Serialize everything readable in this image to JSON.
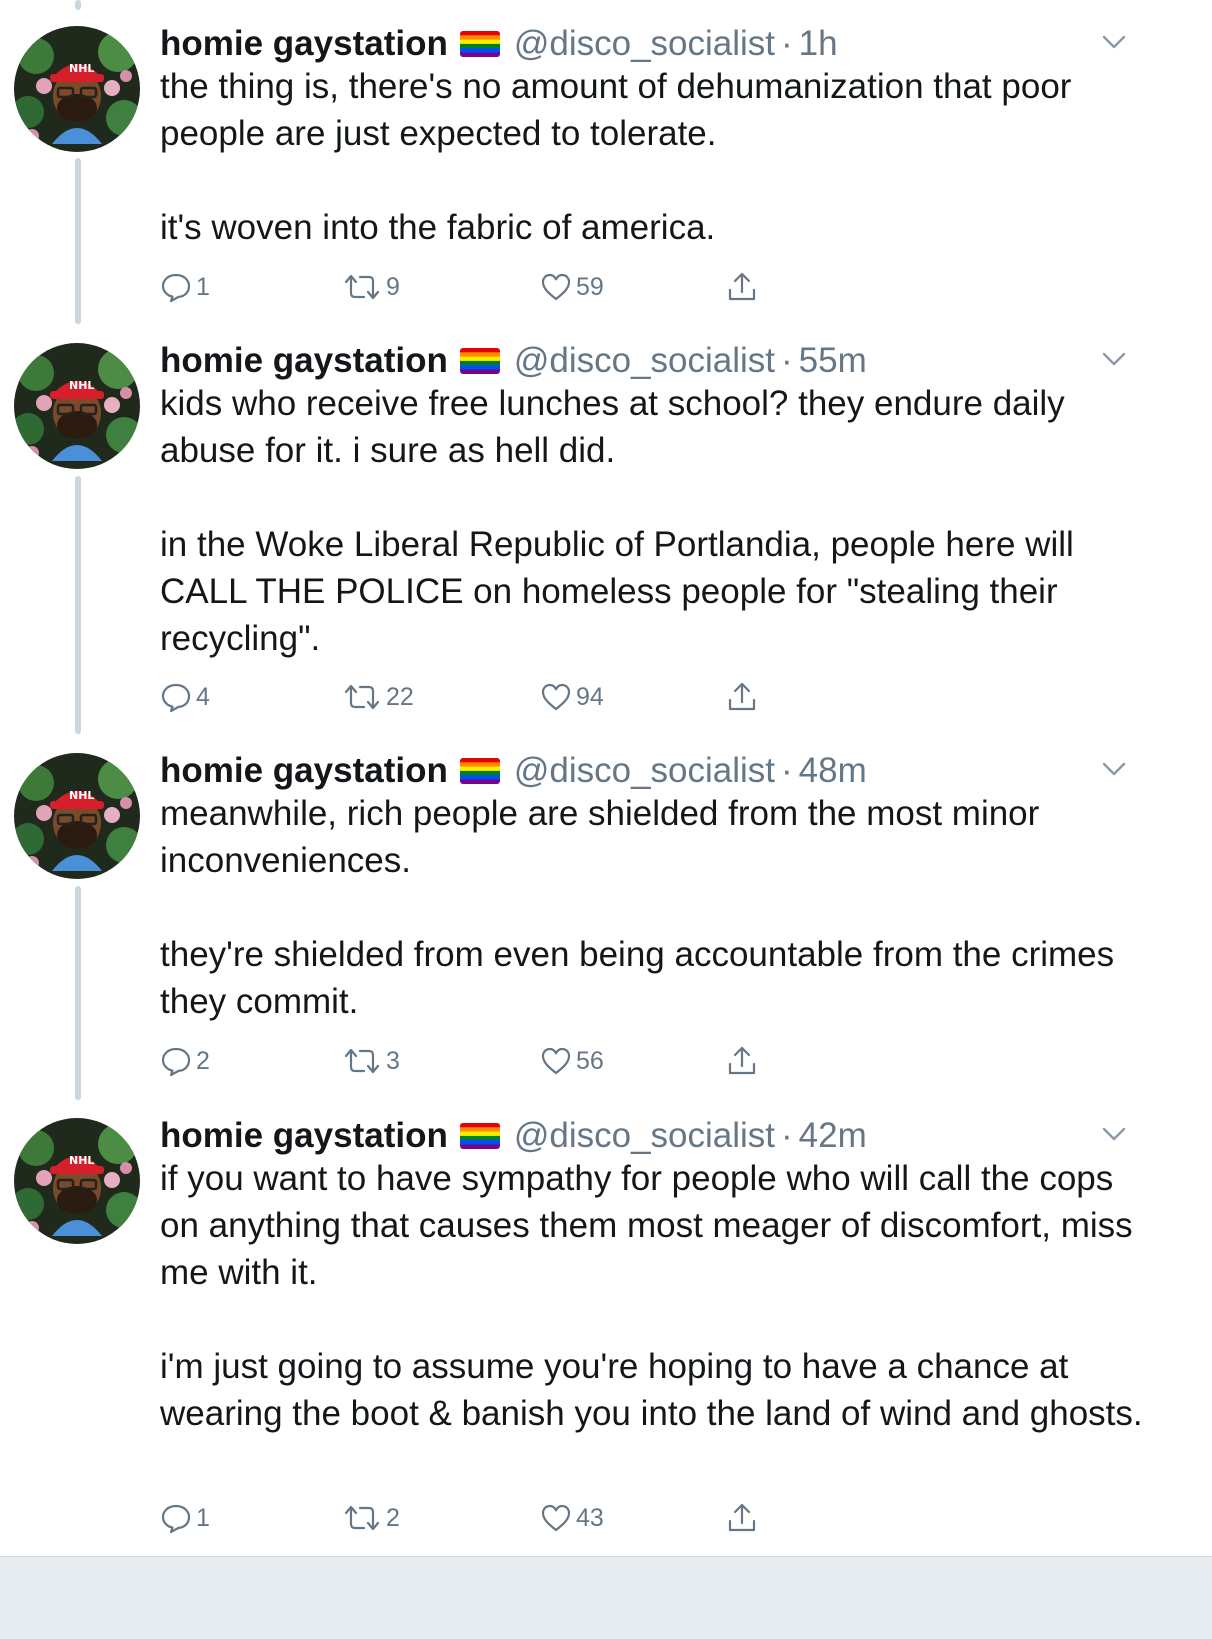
{
  "colors": {
    "text": "#14171a",
    "secondary": "#657786",
    "thread_line": "#ccd6dd"
  },
  "icons": {
    "reply": "speech-bubble-icon",
    "retweet": "retweet-arrows-icon",
    "like": "heart-outline-icon",
    "share": "share-upload-icon",
    "menu": "chevron-down-icon",
    "flag": "rainbow-flag-icon"
  },
  "tweets": [
    {
      "name": "homie gaystation",
      "handle": "@disco_socialist",
      "separator": "·",
      "time": "1h",
      "paragraphs": [
        "the thing is, there's no amount of dehumanization that poor people are just expected to tolerate.",
        "it's woven into the fabric of america."
      ],
      "replies": "1",
      "retweets": "9",
      "likes": "59"
    },
    {
      "name": "homie gaystation",
      "handle": "@disco_socialist",
      "separator": "·",
      "time": "55m",
      "paragraphs": [
        "kids who receive free lunches at school? they endure daily abuse for it. i sure as hell did.",
        "in the Woke Liberal Republic of Portlandia, people here will CALL THE POLICE on homeless people for \"stealing their recycling\"."
      ],
      "replies": "4",
      "retweets": "22",
      "likes": "94"
    },
    {
      "name": "homie gaystation",
      "handle": "@disco_socialist",
      "separator": "·",
      "time": "48m",
      "paragraphs": [
        "meanwhile, rich people are shielded from the most minor inconveniences.",
        "they're shielded from even being accountable from the crimes they commit."
      ],
      "replies": "2",
      "retweets": "3",
      "likes": "56"
    },
    {
      "name": "homie gaystation",
      "handle": "@disco_socialist",
      "separator": "·",
      "time": "42m",
      "paragraphs": [
        "if you want to have sympathy for people who will call the cops on anything that causes them most meager of discomfort, miss me with it.",
        "i'm just going to assume you're hoping to have a chance at wearing the boot & banish you into the land of wind and ghosts."
      ],
      "replies": "1",
      "retweets": "2",
      "likes": "43"
    }
  ]
}
